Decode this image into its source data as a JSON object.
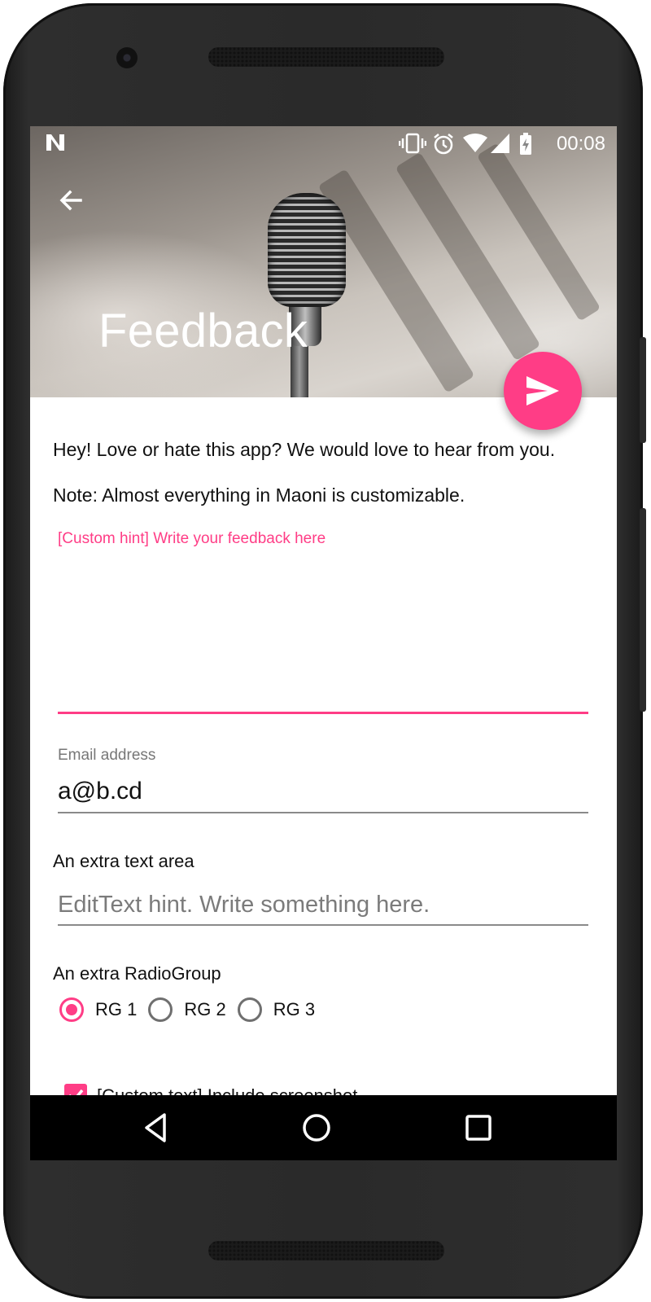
{
  "status_bar": {
    "time": "00:08",
    "left_icon": "n-logo-icon",
    "icons": [
      "vibrate-icon",
      "alarm-icon",
      "wifi-icon",
      "cellular-icon",
      "battery-charging-icon"
    ]
  },
  "header": {
    "title": "Feedback",
    "back_icon": "arrow-back-icon",
    "send_icon": "send-icon"
  },
  "content": {
    "intro_line_1": "Hey! Love or hate this app? We would love to hear from you.",
    "intro_line_2": "Note: Almost everything in Maoni is customizable.",
    "feedback_hint": "[Custom hint] Write your feedback here",
    "email": {
      "label": "Email address",
      "value": "a@b.cd"
    },
    "extra_text_area": {
      "label": "An extra text area",
      "placeholder": "EditText hint. Write something here."
    },
    "radio_group": {
      "label": "An extra RadioGroup",
      "options": [
        "RG 1",
        "RG 2",
        "RG 3"
      ],
      "selected": "RG 1"
    },
    "checkbox": {
      "label": "[Custom text] Include screenshot",
      "checked": true
    }
  },
  "colors": {
    "accent": "#ff3d86",
    "text": "#111111",
    "hint": "#7b7b7b"
  },
  "nav_bar": {
    "icons": [
      "nav-back-icon",
      "nav-home-icon",
      "nav-recents-icon"
    ]
  }
}
